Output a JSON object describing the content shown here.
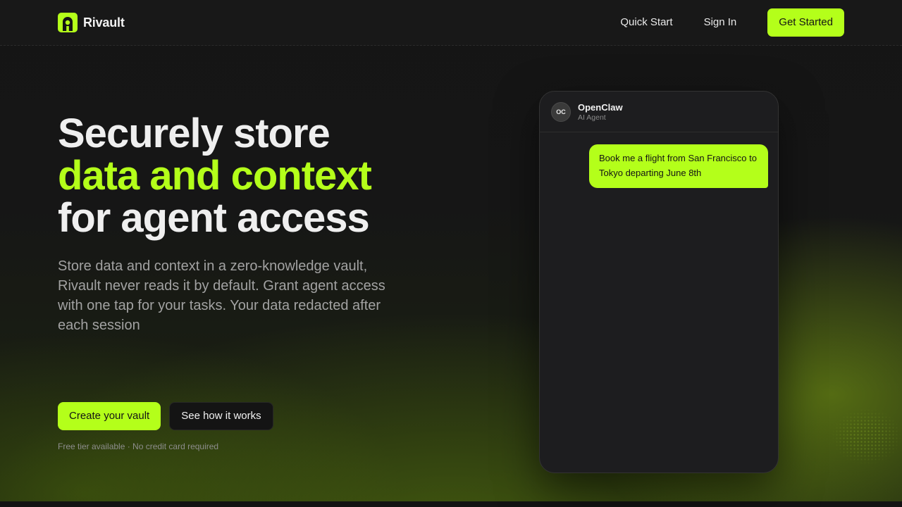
{
  "header": {
    "brand_name": "Rivault",
    "nav": {
      "quick_start": "Quick Start",
      "sign_in": "Sign In",
      "get_started": "Get Started"
    }
  },
  "hero": {
    "headline_line1": "Securely store",
    "headline_line2": "data and context",
    "headline_line3": "for agent access",
    "subtitle": "Store data and context in a zero-knowledge vault, Rivault never reads it by default. Grant agent access with one tap for your tasks. Your data redacted after each session",
    "cta_primary": "Create your vault",
    "cta_secondary": "See how it works",
    "note": "Free tier available · No credit card required"
  },
  "chat": {
    "avatar_initials": "OC",
    "agent_name": "OpenClaw",
    "agent_role": "AI Agent",
    "message": "Book me a flight from San Francisco to Tokyo departing June 8th"
  },
  "colors": {
    "accent": "#b4ff1a",
    "background": "#141414",
    "panel": "#1d1d1f"
  },
  "icons": {
    "logo": "rivault-logo-icon"
  }
}
